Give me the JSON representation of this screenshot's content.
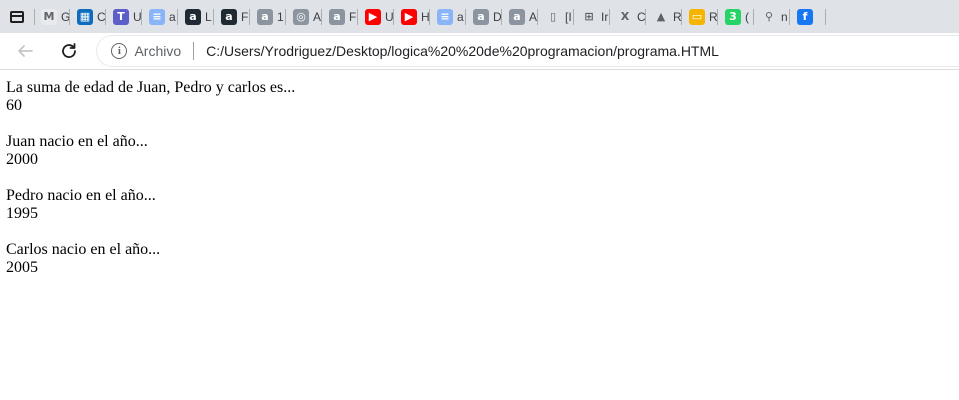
{
  "browser": {
    "tabs": [
      {
        "letter": "G",
        "icon": "gmail-icon",
        "color": "#e8eaed",
        "glyph": "M"
      },
      {
        "letter": "C",
        "icon": "outlook-calendar-icon",
        "color": "#0f6cbd",
        "glyph": "▦"
      },
      {
        "letter": "U",
        "icon": "teams-icon",
        "color": "#5b5fc7",
        "glyph": "T"
      },
      {
        "letter": "a",
        "icon": "google-docs-icon",
        "color": "#8ab4f8",
        "glyph": "≡"
      },
      {
        "letter": "L",
        "icon": "a-letter-icon",
        "color": "#1f2a33",
        "glyph": "a"
      },
      {
        "letter": "F",
        "icon": "a-letter-icon",
        "color": "#1f2a33",
        "glyph": "a"
      },
      {
        "letter": "1",
        "icon": "a-letter-icon",
        "color": "#8c959f",
        "glyph": "a"
      },
      {
        "letter": "A",
        "icon": "github-icon",
        "color": "#8c959f",
        "glyph": "◎"
      },
      {
        "letter": "F",
        "icon": "a-letter-icon",
        "color": "#8c959f",
        "glyph": "a"
      },
      {
        "letter": "U",
        "icon": "youtube-icon",
        "color": "#ff0000",
        "glyph": "▶"
      },
      {
        "letter": "H",
        "icon": "youtube-icon",
        "color": "#ff0000",
        "glyph": "▶"
      },
      {
        "letter": "a",
        "icon": "google-docs-icon",
        "color": "#8ab4f8",
        "glyph": "≡"
      },
      {
        "letter": "D",
        "icon": "a-letter-icon",
        "color": "#8c959f",
        "glyph": "a"
      },
      {
        "letter": "A",
        "icon": "a-letter-icon",
        "color": "#8c959f",
        "glyph": "a"
      },
      {
        "letter": "[I",
        "icon": "page-icon",
        "color": "#dfe3e8",
        "glyph": "▯"
      },
      {
        "letter": "Ir",
        "icon": "microsoft-icon",
        "color": "#dfe3e8",
        "glyph": "⊞"
      },
      {
        "letter": "C",
        "icon": "excel-icon",
        "color": "#dfe3e8",
        "glyph": "X"
      },
      {
        "letter": "R",
        "icon": "google-drive-icon",
        "color": "#dfe3e8",
        "glyph": "▲"
      },
      {
        "letter": "R",
        "icon": "google-slides-icon",
        "color": "#f4b400",
        "glyph": "▭"
      },
      {
        "letter": "(",
        "icon": "whatsapp-icon",
        "color": "#25d366",
        "glyph": "3"
      },
      {
        "letter": "n",
        "icon": "search-icon",
        "color": "#dfe3e8",
        "glyph": "⚲"
      },
      {
        "letter": "",
        "icon": "facebook-icon",
        "color": "#1877f2",
        "glyph": "f"
      }
    ],
    "toolbar": {
      "chip_label": "Archivo",
      "url": "C:/Users/Yrodriguez/Desktop/logica%20%20de%20programacion/programa.HTML"
    }
  },
  "page": {
    "blocks": [
      {
        "label": "La suma de edad de Juan, Pedro y carlos es...",
        "value": "60"
      },
      {
        "label": "Juan nacio en el año...",
        "value": "2000"
      },
      {
        "label": "Pedro nacio en el año...",
        "value": "1995"
      },
      {
        "label": "Carlos nacio en el año...",
        "value": "2005"
      }
    ]
  }
}
